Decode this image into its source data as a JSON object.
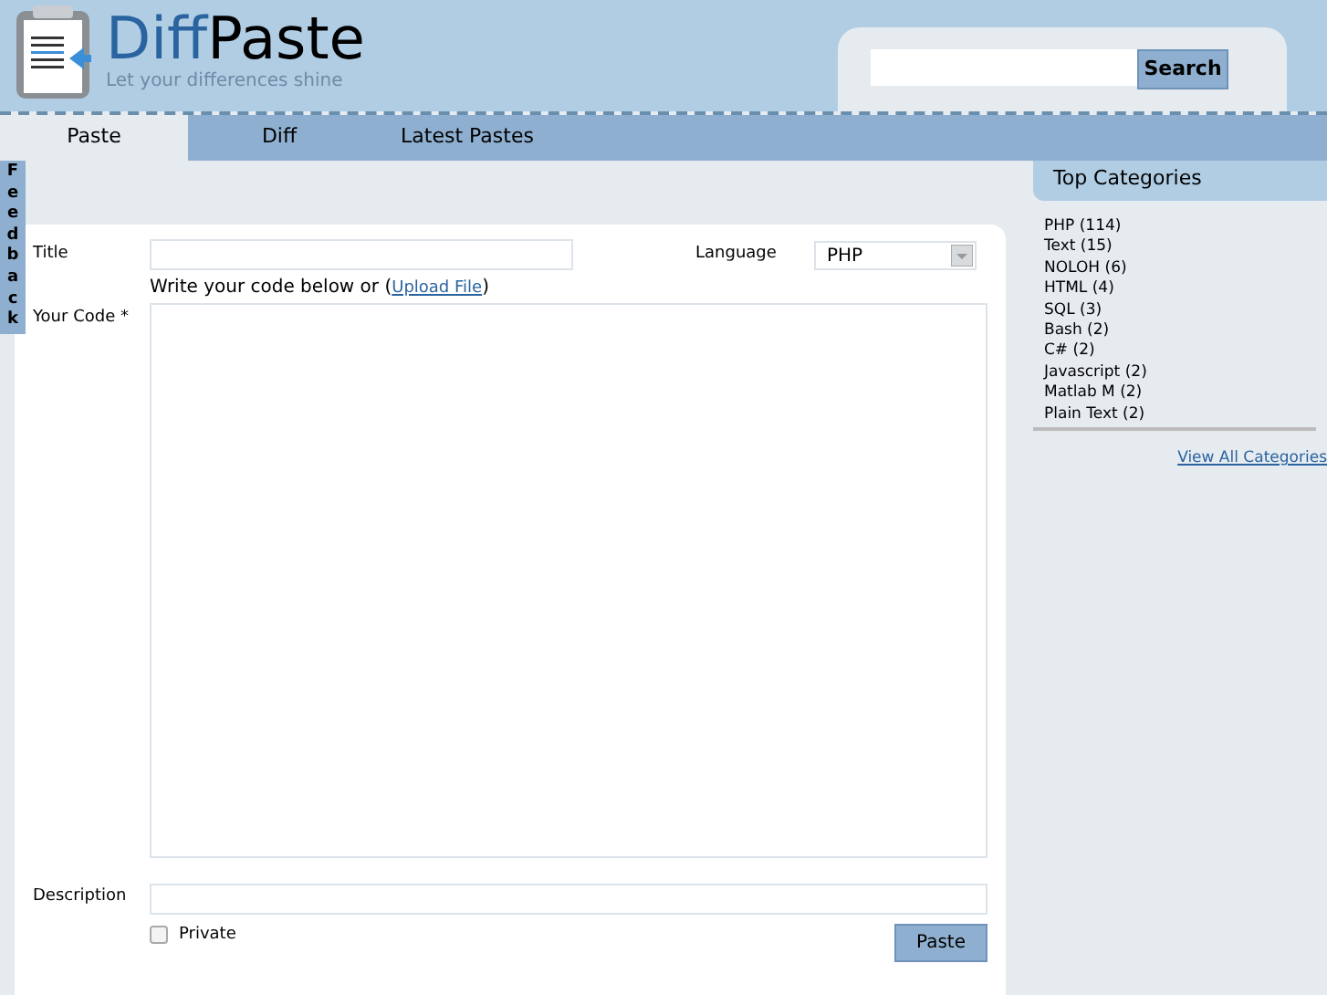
{
  "logo": {
    "part_1": "Diff",
    "part_2": "Paste",
    "tagline": "Let your differences shine"
  },
  "search": {
    "button": "Search"
  },
  "tabs": [
    {
      "label": "Paste",
      "selected": true
    },
    {
      "label": "Diff",
      "selected": false
    },
    {
      "label": "Latest Pastes",
      "selected": false
    }
  ],
  "feedback": "Feedback",
  "form": {
    "title_label": "Title",
    "language_label": "Language",
    "language_value": "PHP",
    "code_hint": "Write your code below or (",
    "upload_link": "Upload File",
    "code_hint_end": ")",
    "code_label": "Your Code *",
    "description_label": "Description",
    "private": {
      "label": "Private",
      "checked": false
    },
    "submit": "Paste"
  },
  "sidebar": {
    "title": "Top Categories",
    "items": [
      "PHP (114)",
      "Text (15)",
      "NOLOH (6)",
      "HTML (4)",
      "SQL (3)",
      "Bash (2)",
      "C# (2)",
      "Javascript (2)",
      "Matlab M (2)",
      "Plain Text (2)"
    ],
    "link": "View All Categories"
  }
}
